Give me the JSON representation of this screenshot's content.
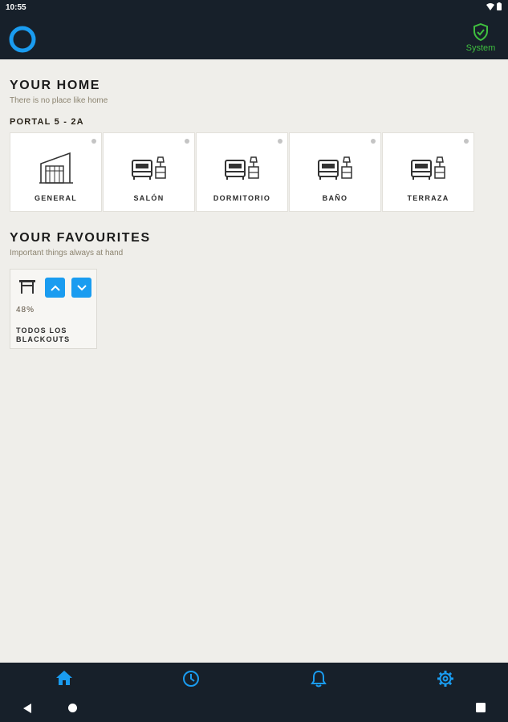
{
  "status_bar": {
    "time": "10:55"
  },
  "appbar": {
    "system_label": "System"
  },
  "home": {
    "title": "YOUR HOME",
    "subtitle": "There is no place like home",
    "portal": "PORTAL 5 - 2A",
    "rooms": [
      {
        "label": "GENERAL",
        "icon": "building-icon"
      },
      {
        "label": "SALÓN",
        "icon": "bedroom-icon"
      },
      {
        "label": "DORMITORIO",
        "icon": "bedroom-icon"
      },
      {
        "label": "BAÑO",
        "icon": "bedroom-icon"
      },
      {
        "label": "TERRAZA",
        "icon": "bedroom-icon"
      }
    ]
  },
  "favourites": {
    "title": "YOUR FAVOURITES",
    "subtitle": "Important things always at hand",
    "items": [
      {
        "percent": "48%",
        "name": "TODOS LOS BLACKOUTS",
        "icon": "blind-icon"
      }
    ]
  },
  "bottom_nav": [
    "home-icon",
    "clock-icon",
    "bell-icon",
    "gear-icon"
  ],
  "colors": {
    "accent": "#1a9cf0",
    "bar": "#17202a",
    "system_green": "#3fbf3f",
    "background": "#efeeea"
  }
}
